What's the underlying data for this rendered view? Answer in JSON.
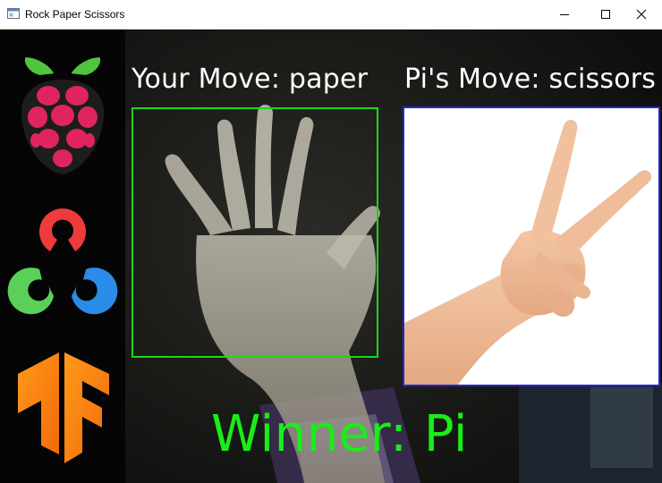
{
  "window": {
    "title": "Rock Paper Scissors"
  },
  "game": {
    "your_move_label": "Your Move: paper",
    "pi_move_label": "Pi's Move: scissors",
    "winner_label": "Winner: Pi"
  },
  "colors": {
    "your_frame": "#18d818",
    "pi_frame": "#2424d8",
    "winner_text": "#18ee18",
    "label_text": "#ffffff"
  },
  "logos": [
    "raspberry-pi-logo",
    "opencv-logo",
    "tensorflow-logo"
  ],
  "icons": [
    "app-icon",
    "minimize-icon",
    "maximize-icon",
    "close-icon"
  ]
}
